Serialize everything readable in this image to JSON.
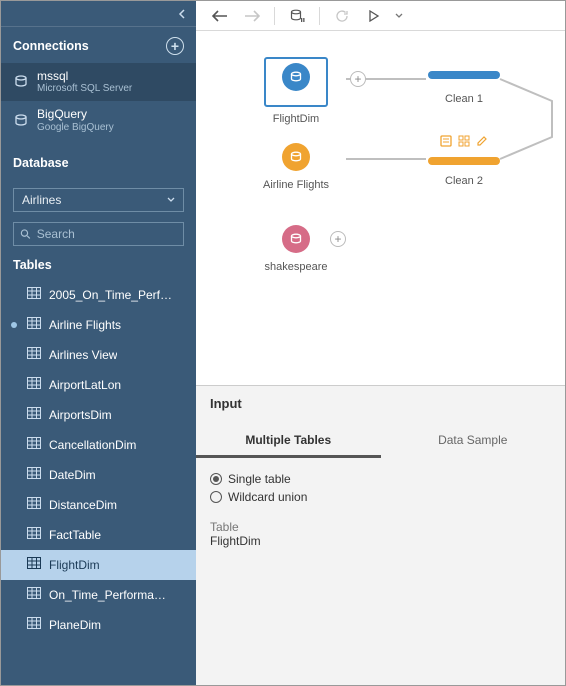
{
  "sidebar": {
    "connections_label": "Connections",
    "connections": [
      {
        "name": "mssql",
        "sub": "Microsoft SQL Server"
      },
      {
        "name": "BigQuery",
        "sub": "Google BigQuery"
      }
    ],
    "database_label": "Database",
    "database_selected": "Airlines",
    "search_placeholder": "Search",
    "tables_label": "Tables",
    "tables": [
      {
        "label": "2005_On_Time_Perf…"
      },
      {
        "label": "Airline Flights",
        "has_dot": true
      },
      {
        "label": "Airlines View"
      },
      {
        "label": "AirportLatLon"
      },
      {
        "label": "AirportsDim"
      },
      {
        "label": "CancellationDim"
      },
      {
        "label": "DateDim"
      },
      {
        "label": "DistanceDim"
      },
      {
        "label": "FactTable"
      },
      {
        "label": "FlightDim",
        "selected": true
      },
      {
        "label": "On_Time_Performa…"
      },
      {
        "label": "PlaneDim"
      }
    ]
  },
  "canvas": {
    "nodes": {
      "flightdim": "FlightDim",
      "airline_flights": "Airline Flights",
      "shakespeare": "shakespeare",
      "clean1": "Clean 1",
      "clean2": "Clean 2"
    }
  },
  "details": {
    "title": "Input",
    "tabs": {
      "multiple": "Multiple Tables",
      "sample": "Data Sample"
    },
    "radios": {
      "single": "Single table",
      "wildcard": "Wildcard union"
    },
    "table_label": "Table",
    "table_value": "FlightDim"
  }
}
